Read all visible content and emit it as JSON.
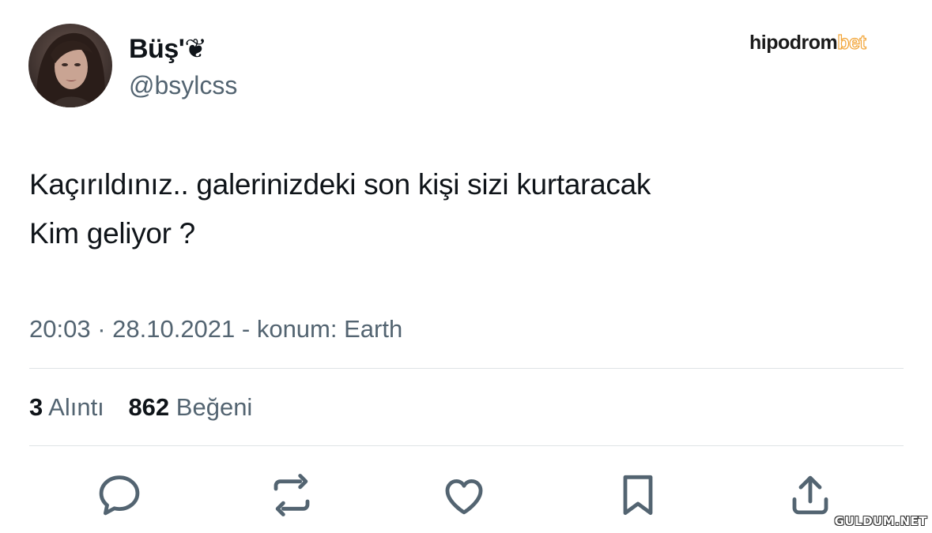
{
  "author": {
    "display_name": "Büş'❦",
    "handle": "@bsylcss",
    "avatar_icon": "user-avatar-photo"
  },
  "brand": {
    "part1": "hipodrom",
    "part2": "bet",
    "accent_color": "#f2a436"
  },
  "tweet": {
    "line1": "Kaçırıldınız.. galerinizdeki son kişi sizi kurtaracak",
    "line2": "Kim geliyor ?",
    "meta": "20:03 · 28.10.2021 - konum: Earth"
  },
  "stats": {
    "quotes_count": "3",
    "quotes_label": "Alıntı",
    "likes_count": "862",
    "likes_label": "Beğeni"
  },
  "actions": [
    "reply-icon",
    "retweet-icon",
    "like-icon",
    "bookmark-icon",
    "share-icon"
  ],
  "colors": {
    "text": "#0f1419",
    "secondary": "#536471",
    "divider": "#dfe3e6"
  },
  "watermark": "GULDUM.NET"
}
